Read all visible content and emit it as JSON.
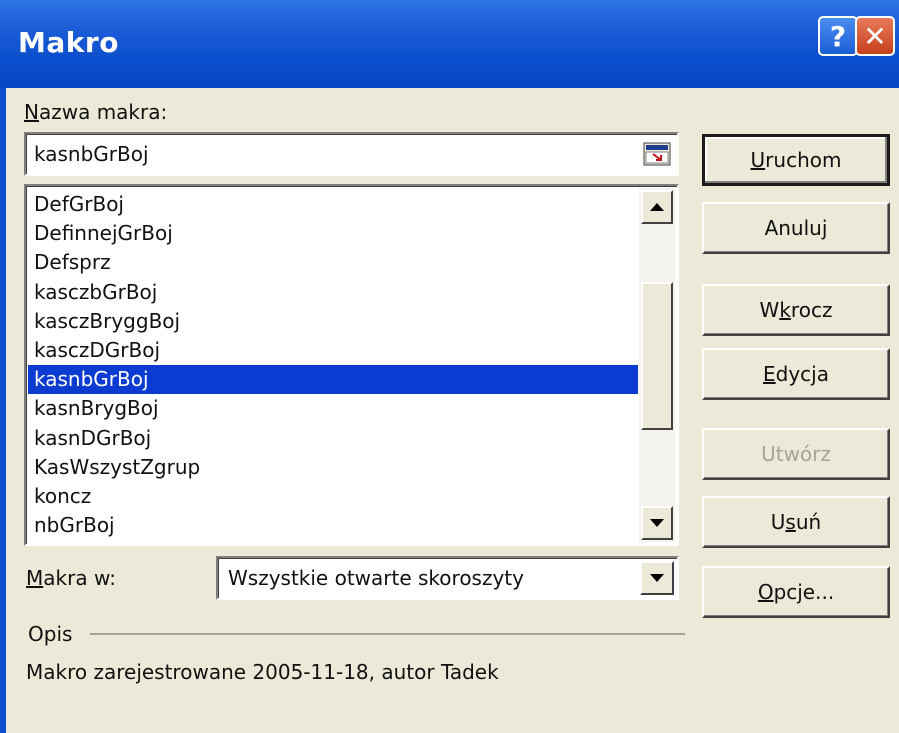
{
  "window": {
    "title": "Makro",
    "help_label": "?",
    "close_label": "✕"
  },
  "macro_name": {
    "label_first": "N",
    "label_rest": "azwa makra:",
    "value": "kasnbGrBoj"
  },
  "macro_list": {
    "items": [
      {
        "label": "DefGrBoj",
        "selected": false
      },
      {
        "label": "DefinnejGrBoj",
        "selected": false
      },
      {
        "label": "Defsprz",
        "selected": false
      },
      {
        "label": "kasczbGrBoj",
        "selected": false
      },
      {
        "label": "kasczBryggBoj",
        "selected": false
      },
      {
        "label": "kasczDGrBoj",
        "selected": false
      },
      {
        "label": "kasnbGrBoj",
        "selected": true
      },
      {
        "label": "kasnBrygBoj",
        "selected": false
      },
      {
        "label": "kasnDGrBoj",
        "selected": false
      },
      {
        "label": "KasWszystZgrup",
        "selected": false
      },
      {
        "label": "koncz",
        "selected": false
      },
      {
        "label": "nbGrBoj",
        "selected": false
      }
    ]
  },
  "buttons": {
    "run": {
      "accel": "U",
      "rest": "ruchom"
    },
    "cancel": {
      "label": "Anuluj"
    },
    "step": {
      "pre": "W",
      "accel": "k",
      "rest": "rocz"
    },
    "edit": {
      "accel": "E",
      "rest": "dycja"
    },
    "create": {
      "label": "Utwórz"
    },
    "delete": {
      "pre": "U",
      "accel": "s",
      "rest": "uń"
    },
    "options": {
      "accel": "O",
      "rest": "pcje..."
    }
  },
  "macros_in": {
    "label_first": "M",
    "label_rest": "akra w:",
    "value": "Wszystkie otwarte skoroszyty"
  },
  "description": {
    "heading": "Opis",
    "text": "Makro zarejestrowane 2005-11-18, autor Tadek"
  },
  "colors": {
    "titlebar": "#0a4dcc",
    "dialog": "#ECE9D8",
    "selection": "#0b3bd1",
    "close": "#c6411d"
  }
}
